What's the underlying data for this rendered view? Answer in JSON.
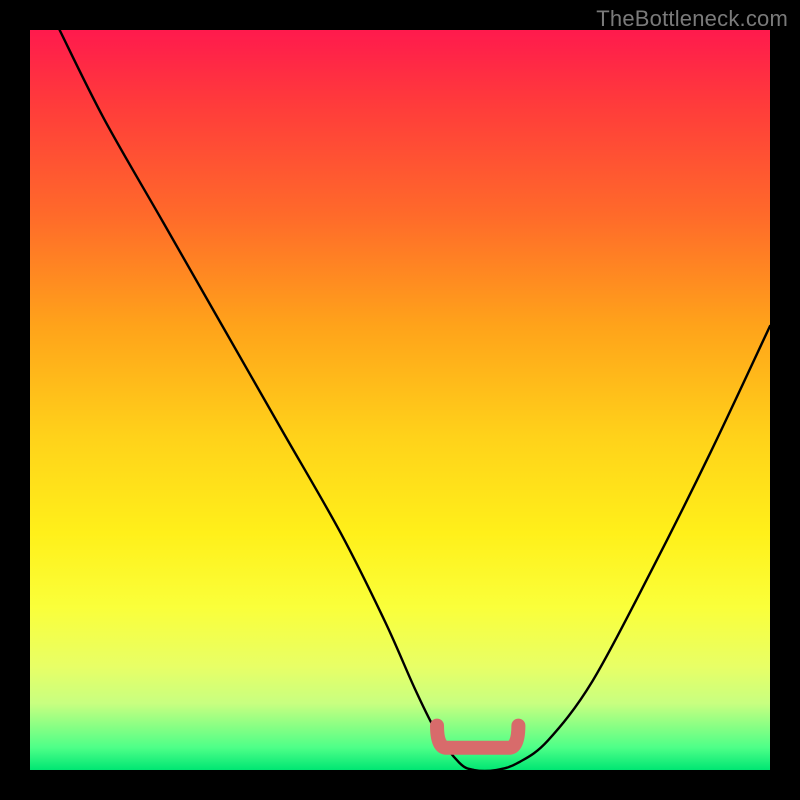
{
  "watermark": "TheBottleneck.com",
  "chart_data": {
    "type": "line",
    "title": "",
    "xlabel": "",
    "ylabel": "",
    "xlim": [
      0,
      100
    ],
    "ylim": [
      0,
      100
    ],
    "series": [
      {
        "name": "bottleneck-curve",
        "x": [
          4,
          10,
          18,
          26,
          34,
          42,
          48,
          52,
          55,
          58,
          60,
          63,
          66,
          70,
          76,
          84,
          92,
          100
        ],
        "values": [
          100,
          88,
          74,
          60,
          46,
          32,
          20,
          11,
          5,
          1,
          0,
          0,
          1,
          4,
          12,
          27,
          43,
          60
        ]
      }
    ],
    "annotations": [
      {
        "name": "optimal-zone-marker",
        "x_start": 55,
        "x_end": 66,
        "y": 3,
        "color": "#d86b6b"
      }
    ],
    "background": {
      "gradient": "vertical",
      "stops": [
        {
          "pos": 0,
          "color": "#ff1a4d"
        },
        {
          "pos": 25,
          "color": "#ff6a2a"
        },
        {
          "pos": 55,
          "color": "#ffd21a"
        },
        {
          "pos": 78,
          "color": "#faff3a"
        },
        {
          "pos": 97,
          "color": "#4dff88"
        },
        {
          "pos": 100,
          "color": "#00e673"
        }
      ]
    }
  }
}
